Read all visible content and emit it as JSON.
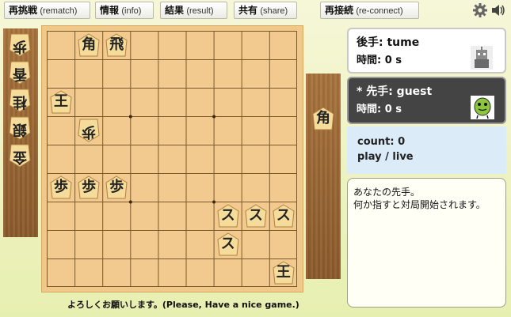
{
  "toolbar": {
    "rematch": {
      "jp": "再挑戦",
      "en": "(rematch)"
    },
    "info": {
      "jp": "情報",
      "en": "(info)"
    },
    "result": {
      "jp": "結果",
      "en": "(result)"
    },
    "share": {
      "jp": "共有",
      "en": "(share)"
    },
    "reconnect": {
      "jp": "再接続",
      "en": "(re-connect)"
    },
    "icons": [
      "settings-gear-icon",
      "sound-speaker-icon"
    ]
  },
  "players": {
    "gote": {
      "name": "後手: tume",
      "time": "時間: 0 s",
      "avatar": "robot-avatar"
    },
    "sente": {
      "name": "* 先手: guest",
      "time": "時間: 0 s",
      "avatar": "green-blob-avatar"
    }
  },
  "status": {
    "count": "count: 0",
    "mode": "play / live"
  },
  "chat": {
    "lines": [
      "あなたの先手。",
      "何か指すと対局開始されます。"
    ]
  },
  "greeting": "よろしくお願いします。(Please, Have a nice game.)",
  "hands": {
    "gote": [
      "歩",
      "香",
      "桂",
      "銀",
      "金"
    ],
    "sente": [
      "角"
    ]
  },
  "board": {
    "pieces": [
      {
        "k": "角",
        "row": 1,
        "col": 2,
        "owner": "sente"
      },
      {
        "k": "飛",
        "row": 1,
        "col": 3,
        "owner": "sente"
      },
      {
        "k": "王",
        "row": 3,
        "col": 1,
        "owner": "sente"
      },
      {
        "k": "歩",
        "row": 4,
        "col": 2,
        "owner": "gote"
      },
      {
        "k": "歩",
        "row": 6,
        "col": 1,
        "owner": "sente"
      },
      {
        "k": "歩",
        "row": 6,
        "col": 2,
        "owner": "sente"
      },
      {
        "k": "歩",
        "row": 6,
        "col": 3,
        "owner": "sente"
      },
      {
        "k": "ス",
        "row": 7,
        "col": 7,
        "owner": "sente"
      },
      {
        "k": "ス",
        "row": 7,
        "col": 8,
        "owner": "sente"
      },
      {
        "k": "ス",
        "row": 7,
        "col": 9,
        "owner": "sente"
      },
      {
        "k": "ス",
        "row": 8,
        "col": 7,
        "owner": "sente"
      },
      {
        "k": "王",
        "row": 9,
        "col": 9,
        "owner": "sente"
      }
    ]
  },
  "colors": {
    "board": "#f2c98f",
    "stand": "#9a6633",
    "active_panel": "#444444",
    "status_bg": "#dcebf8"
  }
}
